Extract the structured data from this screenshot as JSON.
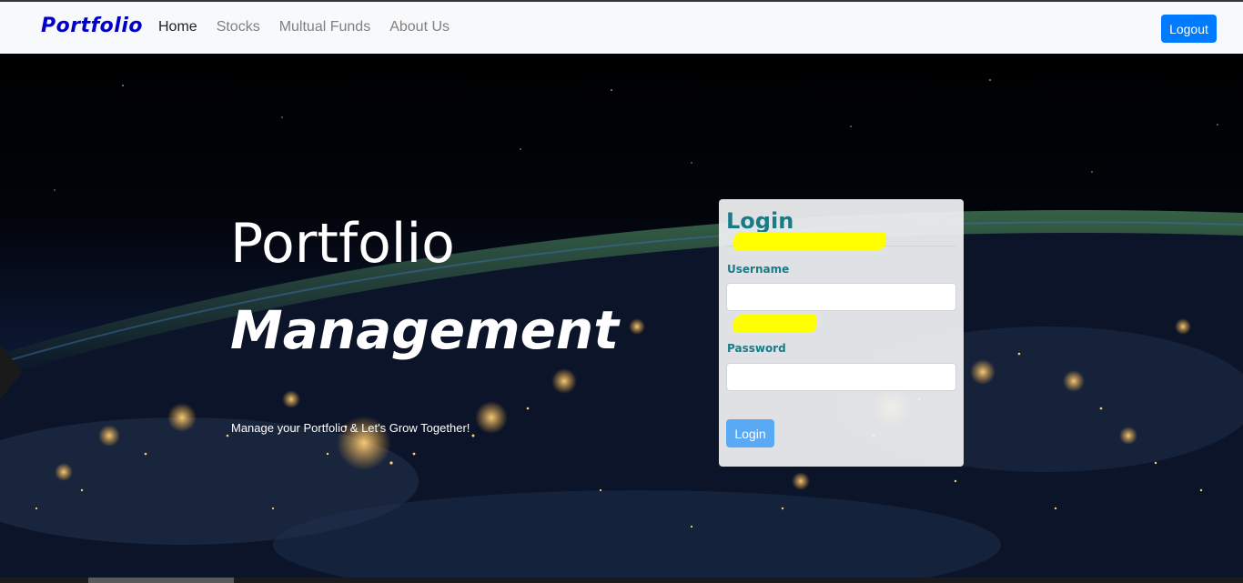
{
  "navbar": {
    "brand": "Portfolio",
    "links": [
      {
        "label": "Home",
        "active": true
      },
      {
        "label": "Stocks",
        "active": false
      },
      {
        "label": "Multual Funds",
        "active": false
      },
      {
        "label": "About Us",
        "active": false
      }
    ],
    "logout_label": "Logout"
  },
  "hero": {
    "title_line1": "Portfolio",
    "title_line2": "Management",
    "tagline": "Manage your Portfolio & Let's Grow Together!"
  },
  "login": {
    "title": "Login",
    "username_label": "Username",
    "username_value": "",
    "password_label": "Password",
    "password_value": "",
    "submit_label": "Login"
  },
  "colors": {
    "brand": "#0000cd",
    "accent": "#007bff",
    "login_heading": "#1a7a86",
    "redaction": "#ffff00"
  }
}
